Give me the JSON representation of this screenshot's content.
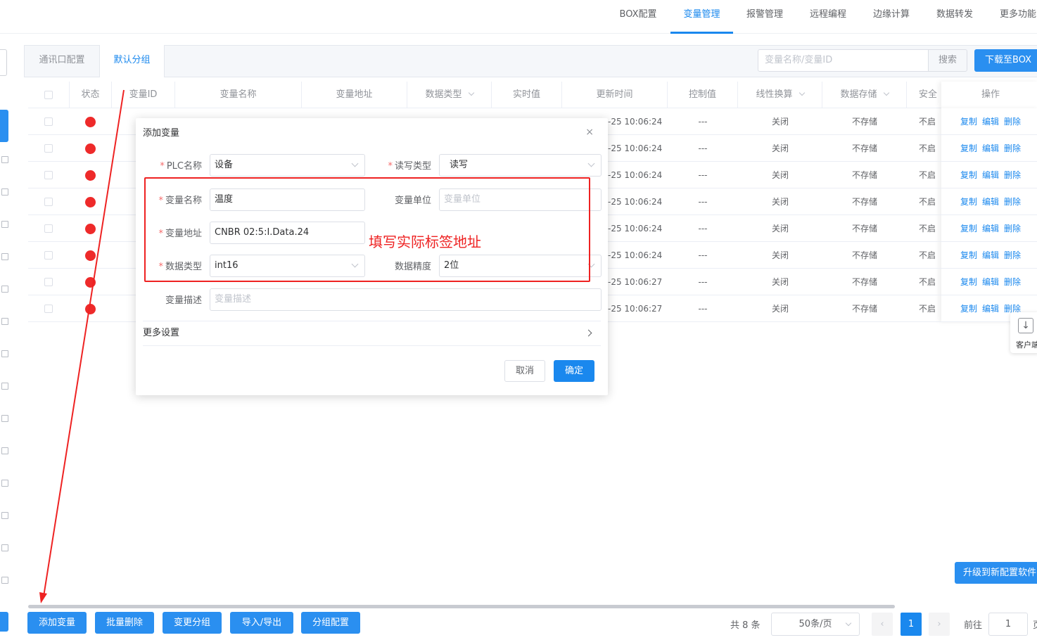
{
  "nav": {
    "tabs": [
      "BOX配置",
      "变量管理",
      "报警管理",
      "远程编程",
      "边缘计算",
      "数据转发",
      "更多功能"
    ],
    "active_tab": "变量管理"
  },
  "subtabs": [
    "通讯口配置",
    "默认分组"
  ],
  "toolbar": {
    "search_placeholder": "变量名称/变量ID",
    "search_label": "搜索",
    "download_label": "下载至BOX"
  },
  "table": {
    "headers": [
      "状态",
      "变量ID",
      "变量名称",
      "变量地址",
      "数据类型",
      "实时值",
      "更新时间",
      "控制值",
      "线性换算",
      "数据存储",
      "安全",
      "操作"
    ],
    "rows": [
      {
        "time": "-25 10:06:24",
        "control": "---",
        "linear": "关闭",
        "storage": "不存储",
        "safe": "不启"
      },
      {
        "time": "-25 10:06:24",
        "control": "---",
        "linear": "关闭",
        "storage": "不存储",
        "safe": "不启"
      },
      {
        "time": "-25 10:06:24",
        "control": "---",
        "linear": "关闭",
        "storage": "不存储",
        "safe": "不启"
      },
      {
        "time": "-25 10:06:24",
        "control": "---",
        "linear": "关闭",
        "storage": "不存储",
        "safe": "不启"
      },
      {
        "time": "-25 10:06:24",
        "control": "---",
        "linear": "关闭",
        "storage": "不存储",
        "safe": "不启"
      },
      {
        "time": "-25 10:06:24",
        "control": "---",
        "linear": "关闭",
        "storage": "不存储",
        "safe": "不启"
      },
      {
        "time": "-25 10:06:27",
        "control": "---",
        "linear": "关闭",
        "storage": "不存储",
        "safe": "不启"
      },
      {
        "time": "-25 10:06:27",
        "control": "---",
        "linear": "关闭",
        "storage": "不存储",
        "safe": "不启"
      }
    ],
    "ops": {
      "copy": "复制",
      "edit": "编辑",
      "delete": "删除"
    }
  },
  "dialog": {
    "title": "添加变量",
    "close": "×",
    "plc_label": "PLC名称",
    "plc_value": "设备",
    "rw_label": "读写类型",
    "rw_value": "读写",
    "name_label": "变量名称",
    "name_value": "温度",
    "unit_label": "变量单位",
    "unit_placeholder": "变量单位",
    "addr_label": "变量地址",
    "addr_value": "CNBR 02:5:I.Data.24",
    "type_label": "数据类型",
    "type_value": "int16",
    "precision_label": "数据精度",
    "precision_value": "2位",
    "desc_label": "变量描述",
    "desc_placeholder": "变量描述",
    "more_settings": "更多设置",
    "cancel": "取消",
    "ok": "确定"
  },
  "annotation": {
    "text": "填写实际标签地址",
    "color": "#ee2222"
  },
  "footer": {
    "buttons": [
      "添加变量",
      "批量删除",
      "变更分组",
      "导入/导出",
      "分组配置"
    ],
    "total": "共 8 条",
    "page_size": "50条/页",
    "prev": "‹",
    "current_page": "1",
    "next": "›",
    "goto_label": "前往",
    "goto_value": "1",
    "page_suffix": "页"
  },
  "side": {
    "upgrade_label": "升级到新配置软件",
    "client_label": "客户端",
    "client_icon": "download-icon"
  },
  "colors": {
    "primary": "#1a88ee",
    "button": "#2a8ff0",
    "status_red": "#ee2a2a"
  }
}
